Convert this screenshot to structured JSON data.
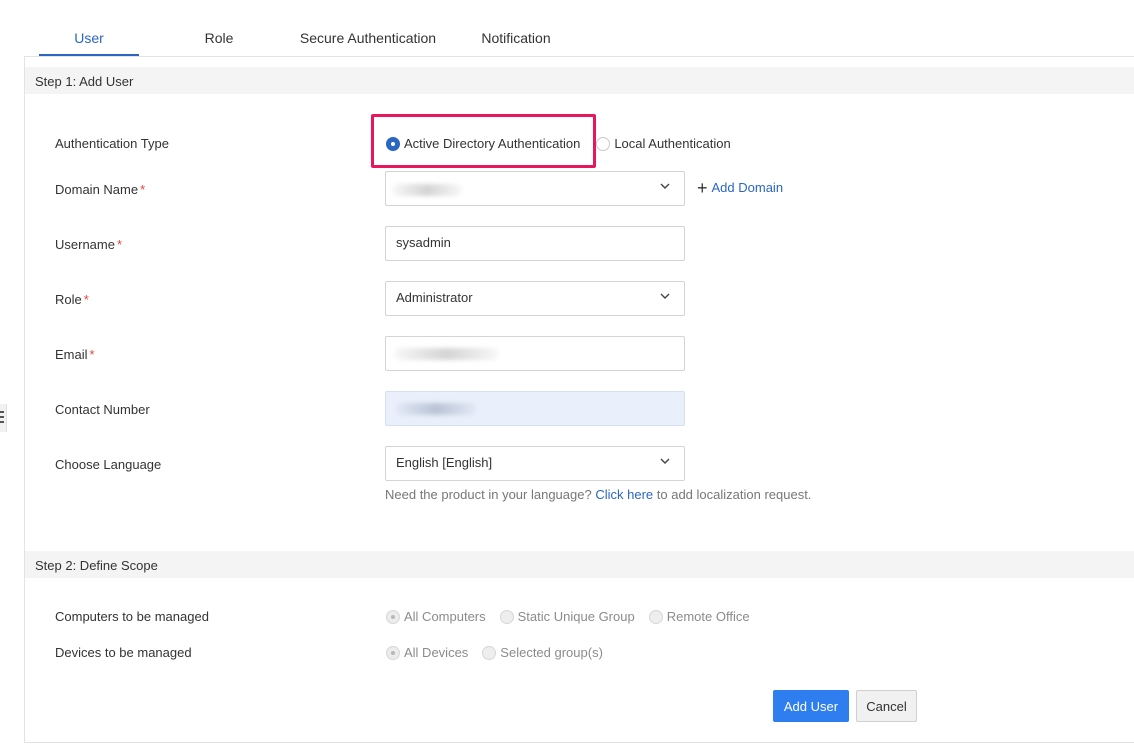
{
  "tabs": [
    {
      "label": "User",
      "active": true
    },
    {
      "label": "Role",
      "active": false
    },
    {
      "label": "Secure Authentication",
      "active": false
    },
    {
      "label": "Notification",
      "active": false
    }
  ],
  "step1": {
    "title": "Step 1: Add User",
    "auth_type": {
      "label": "Authentication Type",
      "options": [
        {
          "label": "Active Directory Authentication",
          "selected": true
        },
        {
          "label": "Local Authentication",
          "selected": false
        }
      ]
    },
    "domain": {
      "label": "Domain Name",
      "required_mark": "*",
      "value": "",
      "icon": "chevron-down-icon"
    },
    "add_domain": {
      "label": "Add Domain",
      "icon": "plus-icon"
    },
    "username": {
      "label": "Username",
      "required_mark": "*",
      "value": "sysadmin"
    },
    "role": {
      "label": "Role",
      "required_mark": "*",
      "value": "Administrator",
      "icon": "chevron-down-icon"
    },
    "email": {
      "label": "Email",
      "required_mark": "*",
      "value": ""
    },
    "contact": {
      "label": "Contact Number",
      "value": ""
    },
    "language": {
      "label": "Choose Language",
      "value": "English [English]",
      "icon": "chevron-down-icon",
      "hint_prefix": "Need the product in your language?",
      "hint_link": "Click here",
      "hint_suffix": "to add localization request."
    }
  },
  "step2": {
    "title": "Step 2: Define Scope",
    "computers": {
      "label": "Computers to be managed",
      "options": [
        {
          "label": "All Computers",
          "selected": true
        },
        {
          "label": "Static Unique Group",
          "selected": false
        },
        {
          "label": "Remote Office",
          "selected": false
        }
      ]
    },
    "devices": {
      "label": "Devices to be managed",
      "options": [
        {
          "label": "All Devices",
          "selected": true
        },
        {
          "label": "Selected group(s)",
          "selected": false
        }
      ]
    }
  },
  "actions": {
    "add_user": "Add User",
    "cancel": "Cancel"
  },
  "colors": {
    "accent": "#2b66c3",
    "primary_button": "#2f7ef0",
    "highlight": "#e8175d",
    "required": "#e34141"
  }
}
